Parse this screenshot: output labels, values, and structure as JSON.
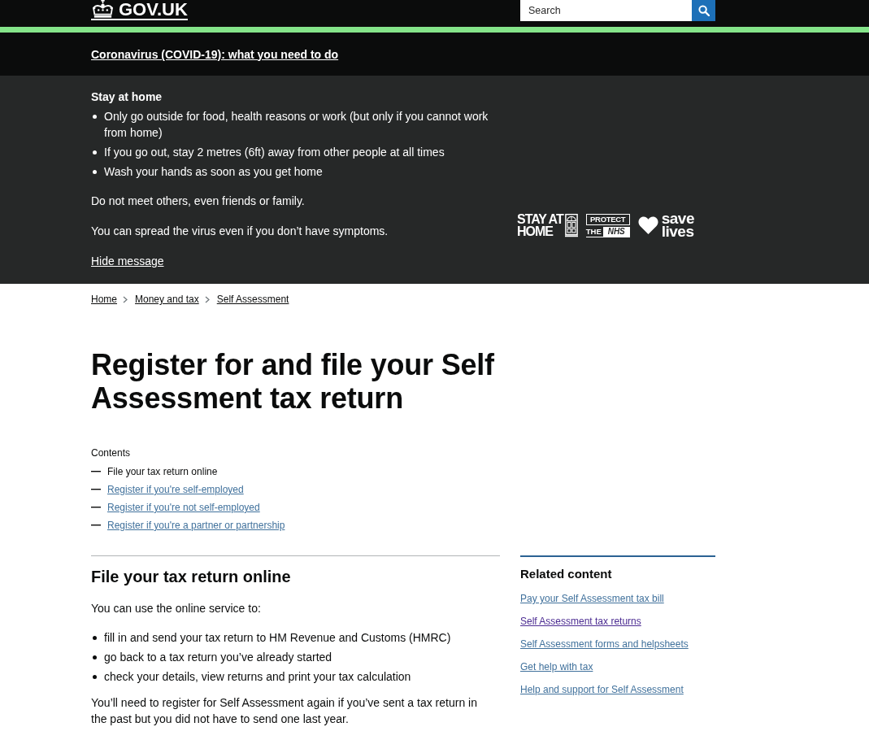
{
  "header": {
    "logo": "GOV.UK",
    "search": {
      "placeholder": "Search"
    }
  },
  "covid_banner": {
    "link": "Coronavirus (COVID-19): what you need to do"
  },
  "stay_home": {
    "heading": "Stay at home",
    "bullets": [
      "Only go outside for food, health reasons or work (but only if you cannot work from home)",
      "If you go out, stay 2 metres (6ft) away from other people at all times",
      "Wash your hands as soon as you get home"
    ],
    "paragraphs": [
      "Do not meet others, even friends or family.",
      "You can spread the virus even if you don’t have symptoms."
    ],
    "hide_link": "Hide message",
    "campaign_logos": [
      {
        "kind": "stay_at_home",
        "lines": [
          "STAY AT",
          "HOME"
        ]
      },
      {
        "kind": "protect_nhs",
        "lines": [
          "PROTECT",
          "THE",
          "NHS"
        ]
      },
      {
        "kind": "save_lives",
        "lines": [
          "save",
          "lives"
        ]
      }
    ]
  },
  "breadcrumbs": [
    "Home",
    "Money and tax",
    "Self Assessment"
  ],
  "title": "Register for and file your Self Assessment tax return",
  "contents": {
    "label": "Contents",
    "items": [
      {
        "label": "File your tax return online",
        "selected": true
      },
      {
        "label": "Register if you're self-employed",
        "selected": false
      },
      {
        "label": "Register if you're not self-employed",
        "selected": false
      },
      {
        "label": "Register if you're a partner or partnership",
        "selected": false
      }
    ]
  },
  "section": {
    "heading": "File your tax return online",
    "intro": "You can use the online service to:",
    "bullets": [
      "fill in and send your tax return to HM Revenue and Customs (HMRC)",
      "go back to a tax return you’ve already started",
      "check your details, view returns and print your tax calculation"
    ],
    "paragraphs": [
      "You’ll need to register for Self Assessment again if you’ve sent a tax return in the past but you did not have to send one last year."
    ]
  },
  "related": {
    "heading": "Related content",
    "links": [
      {
        "label": "Pay your Self Assessment tax bill",
        "visited": false
      },
      {
        "label": "Self Assessment tax returns",
        "visited": true
      },
      {
        "label": "Self Assessment forms and helpsheets",
        "visited": false
      },
      {
        "label": "Get help with tax",
        "visited": false
      },
      {
        "label": "Help and support for Self Assessment",
        "visited": false
      }
    ]
  }
}
